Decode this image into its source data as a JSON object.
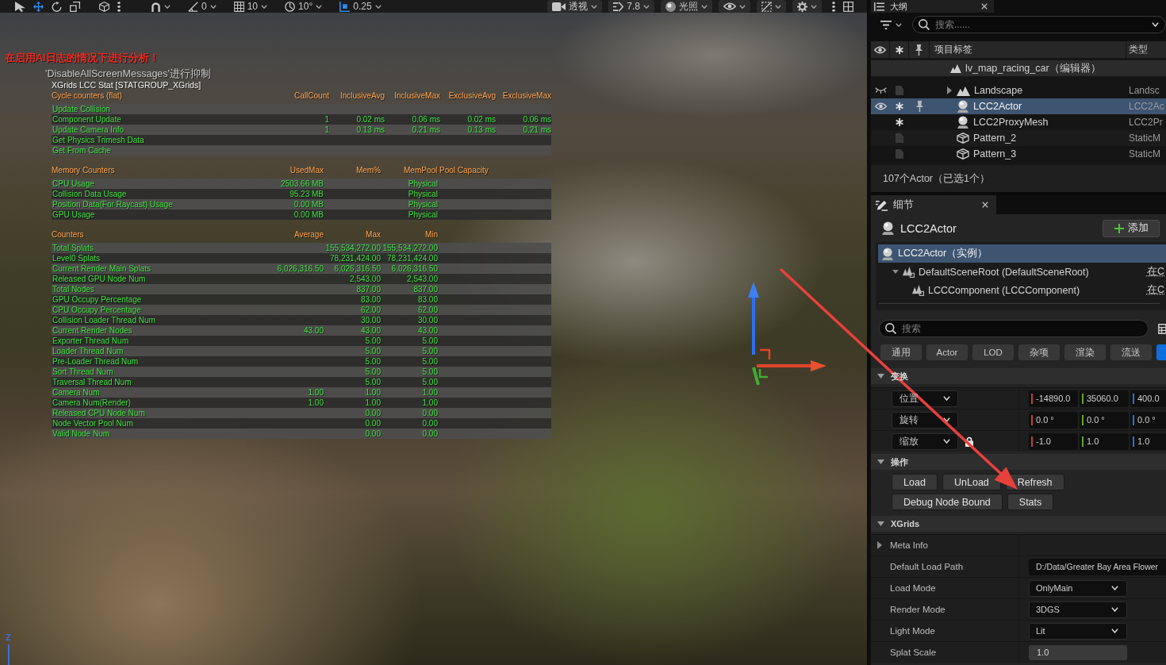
{
  "viewport": {
    "toolbar": {
      "transform_tools": [
        {
          "selected": false
        },
        {
          "selected": true
        },
        {
          "selected": false
        },
        {
          "selected": false
        }
      ],
      "snaps": [
        {
          "value": "0",
          "on": false
        },
        {
          "value": "10",
          "on": false
        },
        {
          "value": "10°",
          "on": false
        },
        {
          "value": "0.25",
          "on": true
        }
      ],
      "view_mode": "透视",
      "camera_speed": "7.8",
      "lighting": "光照"
    },
    "stats": {
      "warning": "在启用AI日志的情况下进行分析！",
      "hint": "'DisableAllScreenMessages'进行抑制",
      "group_title": "XGrids LCC Stat [STATGROUP_XGrids]",
      "tables": [
        {
          "kind": "cycle",
          "columns": [
            "Cycle counters (flat)",
            "CallCount",
            "InclusiveAvg",
            "InclusiveMax",
            "ExclusiveAvg",
            "ExclusiveMax"
          ],
          "rows": [
            {
              "name": "Update Collision"
            },
            {
              "name": "Component Update",
              "call_count": "1",
              "inclusive_avg": "0.02 ms",
              "inclusive_max": "0.06 ms",
              "exclusive_avg": "0.02 ms",
              "exclusive_max": "0.06 ms"
            },
            {
              "name": "Update Camera Info",
              "call_count": "1",
              "inclusive_avg": "0.13 ms",
              "inclusive_max": "0.21 ms",
              "exclusive_avg": "0.13 ms",
              "exclusive_max": "0.21 ms"
            },
            {
              "name": "Get Physics Trimesh Data"
            },
            {
              "name": "Get From Cache"
            }
          ]
        },
        {
          "kind": "memory",
          "columns": [
            "Memory Counters",
            "UsedMax",
            "Mem%",
            "MemPool Pool Capacity"
          ],
          "rows": [
            {
              "name": "CPU Usage",
              "used_max": "2503.66 MB",
              "pool": "Physical"
            },
            {
              "name": "Collision Data Usage",
              "used_max": "95.23 MB",
              "pool": "Physical"
            },
            {
              "name": "Position Data(For Raycast) Usage",
              "used_max": "0.00 MB",
              "pool": "Physical"
            },
            {
              "name": "GPU Usage",
              "used_max": "0.00 MB",
              "pool": "Physical"
            }
          ]
        },
        {
          "kind": "counters",
          "columns": [
            "Counters",
            "Average",
            "Max",
            "Min"
          ],
          "rows": [
            {
              "name": "Total Splats",
              "max": "155,534,272.00",
              "min": "155,534,272.00"
            },
            {
              "name": "Level0 Splats",
              "max": "78,231,424.00",
              "min": "78,231,424.00"
            },
            {
              "name": "Current Render Main Splats",
              "average": "6,026,316.50",
              "max": "6,026,316.50",
              "min": "6,026,316.50"
            },
            {
              "name": "Released GPU Node Num",
              "max": "2,543.00",
              "min": "2,543.00"
            },
            {
              "name": "Total Nodes",
              "max": "837.00",
              "min": "837.00"
            },
            {
              "name": "GPU Occupy Percentage",
              "max": "83.00",
              "min": "83.00"
            },
            {
              "name": "CPU Occupy Percentage",
              "max": "62.00",
              "min": "62.00"
            },
            {
              "name": "Collision Loader Thread Num",
              "max": "30.00",
              "min": "30.00"
            },
            {
              "name": "Current Render Nodes",
              "average": "43.00",
              "max": "43.00",
              "min": "43.00"
            },
            {
              "name": "Exporter Thread Num",
              "max": "5.00",
              "min": "5.00"
            },
            {
              "name": "Loader Thread Num",
              "max": "5.00",
              "min": "5.00"
            },
            {
              "name": "Pre-Loader Thread Num",
              "max": "5.00",
              "min": "5.00"
            },
            {
              "name": "Sort Thread Num",
              "max": "5.00",
              "min": "5.00"
            },
            {
              "name": "Traversal Thread Num",
              "max": "5.00",
              "min": "5.00"
            },
            {
              "name": "Camera Num",
              "average": "1.00",
              "max": "1.00",
              "min": "1.00"
            },
            {
              "name": "Camera Num(Render)",
              "average": "1.00",
              "max": "1.00",
              "min": "1.00"
            },
            {
              "name": "Released CPU Node Num",
              "max": "0.00",
              "min": "0.00"
            },
            {
              "name": "Node Vector Pool Num",
              "max": "0.00",
              "min": "0.00"
            },
            {
              "name": "Valid Node Num",
              "max": "0.00",
              "min": "0.00"
            }
          ]
        }
      ]
    },
    "axis_label": "Z"
  },
  "outliner": {
    "tab": "大纲",
    "search_placeholder": "搜索......",
    "columns": [
      "项目标签",
      "类型"
    ],
    "level": "lv_map_racing_car（编辑器）",
    "rows": [
      {
        "label": "Landscape",
        "type": "Landsc",
        "kind": "landscape",
        "hidden": true,
        "unsaved": false,
        "expandable": true,
        "selected": false
      },
      {
        "label": "LCC2Actor",
        "type": "LCC2Ac",
        "kind": "actor",
        "hidden": false,
        "unsaved": true,
        "expandable": false,
        "selected": true
      },
      {
        "label": "LCC2ProxyMesh",
        "type": "LCC2Pr",
        "kind": "actor",
        "hidden": false,
        "unsaved": true,
        "expandable": false,
        "selected": false
      },
      {
        "label": "Pattern_2",
        "type": "StaticM",
        "kind": "static_mesh",
        "hidden": false,
        "unsaved": false,
        "expandable": false,
        "selected": false
      },
      {
        "label": "Pattern_3",
        "type": "StaticM",
        "kind": "static_mesh",
        "hidden": false,
        "unsaved": false,
        "expandable": false,
        "selected": false
      }
    ],
    "summary": "107个Actor（已选1个）"
  },
  "details": {
    "tab": "细节",
    "actor": "LCC2Actor",
    "add_button": "添加",
    "instance": {
      "label": "LCC2Actor（实例）",
      "selected": true
    },
    "components": [
      {
        "label": "DefaultSceneRoot (DefaultSceneRoot)",
        "link": "在C",
        "selected": false,
        "expanded": true,
        "children": [
          {
            "label": "LCCComponent (LCCComponent)",
            "link": "在C",
            "selected": false
          }
        ]
      }
    ],
    "search_placeholder": "搜索",
    "categories": [
      {
        "label": "通用",
        "selected": false
      },
      {
        "label": "Actor",
        "selected": false
      },
      {
        "label": "LOD",
        "selected": false
      },
      {
        "label": "杂项",
        "selected": false
      },
      {
        "label": "渲染",
        "selected": false
      },
      {
        "label": "流送",
        "selected": false
      },
      {
        "selected": true
      }
    ],
    "sections": [
      {
        "title": "变换",
        "kind": "transform",
        "expanded": true,
        "rows": [
          {
            "label": "位置",
            "values": [
              "-14890.0",
              "35060.0",
              "400.0"
            ],
            "locked": false
          },
          {
            "label": "旋转",
            "values": [
              "0.0 °",
              "0.0 °",
              "0.0 °"
            ],
            "locked": false
          },
          {
            "label": "缩放",
            "values": [
              "-1.0",
              "1.0",
              "1.0"
            ],
            "locked": true
          }
        ]
      },
      {
        "title": "操作",
        "kind": "actions",
        "expanded": true,
        "button_rows": [
          [
            "Load",
            "UnLoad",
            "Refresh"
          ],
          [
            "Debug Node Bound",
            "Stats"
          ]
        ]
      },
      {
        "title": "XGrids",
        "kind": "properties",
        "expanded": true,
        "rows": [
          {
            "label": "Meta Info",
            "kind": "group",
            "expanded": false
          },
          {
            "label": "Default Load Path",
            "kind": "text",
            "value": "D:/Data/Greater Bay Area Flower"
          },
          {
            "label": "Load Mode",
            "kind": "dropdown",
            "value": "OnlyMain"
          },
          {
            "label": "Render Mode",
            "kind": "dropdown",
            "value": "3DGS"
          },
          {
            "label": "Light Mode",
            "kind": "dropdown",
            "value": "Lit"
          },
          {
            "label": "Splat Scale",
            "kind": "number",
            "value": "1.0"
          }
        ]
      }
    ]
  }
}
